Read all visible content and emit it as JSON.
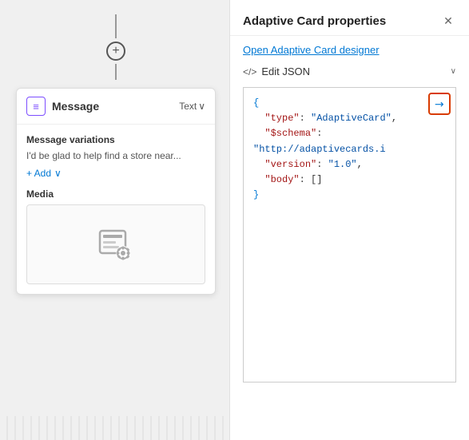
{
  "canvas": {
    "add_button_label": "+",
    "message_card": {
      "icon_symbol": "≡",
      "title": "Message",
      "text_label": "Text",
      "chevron": "∨",
      "variations_label": "Message variations",
      "variation_text": "I'd be glad to help find a store near...",
      "add_label": "+ Add",
      "add_chevron": "∨",
      "media_label": "Media"
    }
  },
  "properties_panel": {
    "title": "Adaptive Card properties",
    "close_label": "✕",
    "open_designer_link": "Open Adaptive Card designer",
    "edit_json_icon": "</>",
    "edit_json_label": "Edit JSON",
    "edit_json_chevron": "∨",
    "expand_icon": "↗",
    "json_content": {
      "line1": "{",
      "line2_key": "\"type\"",
      "line2_val": "\"AdaptiveCard\",",
      "line3_key": "\"$schema\"",
      "line3_val": "\"http://adaptivecards.i",
      "line4_key": "\"version\"",
      "line4_val": "\"1.0\",",
      "line5_key": "\"body\"",
      "line5_val": "[]",
      "line6": "}"
    }
  }
}
